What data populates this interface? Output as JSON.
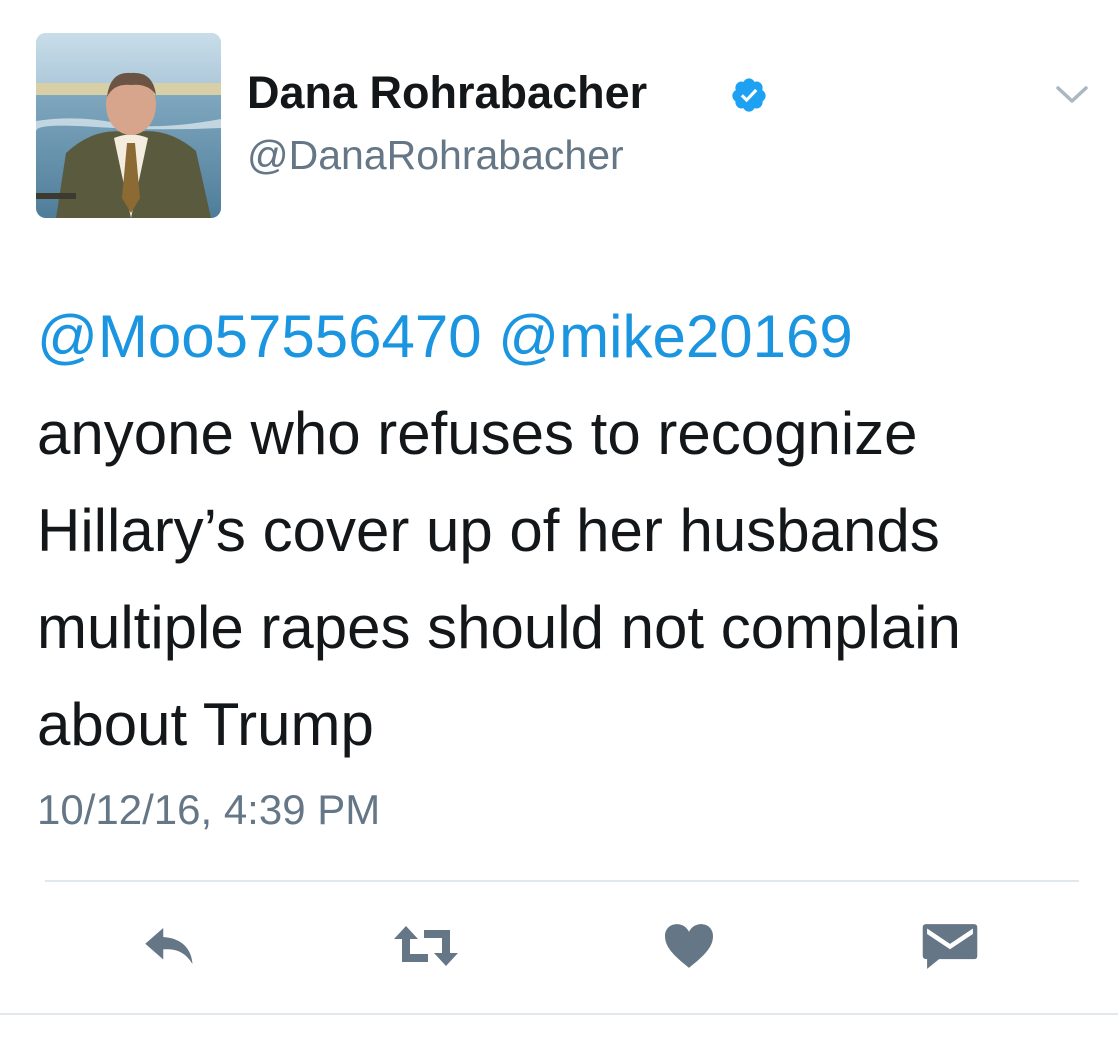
{
  "tweet": {
    "author": {
      "display_name": "Dana Rohrabacher",
      "handle": "@DanaRohrabacher",
      "verified": true
    },
    "text": {
      "mentions": [
        "@Moo57556470",
        "@mike20169"
      ],
      "body": "anyone who refuses to recognize Hillary’s cover up of her husbands multiple rapes should not complain about Trump"
    },
    "timestamp": "10/12/16, 4:39 PM"
  },
  "colors": {
    "mention": "#1b95e0",
    "secondary_text": "#657786",
    "verified_badge": "#1da1f2",
    "action_icon": "#657786"
  },
  "icons": {
    "menu": "chevron-down-icon",
    "reply": "reply-icon",
    "retweet": "retweet-icon",
    "like": "heart-icon",
    "message": "envelope-icon"
  }
}
